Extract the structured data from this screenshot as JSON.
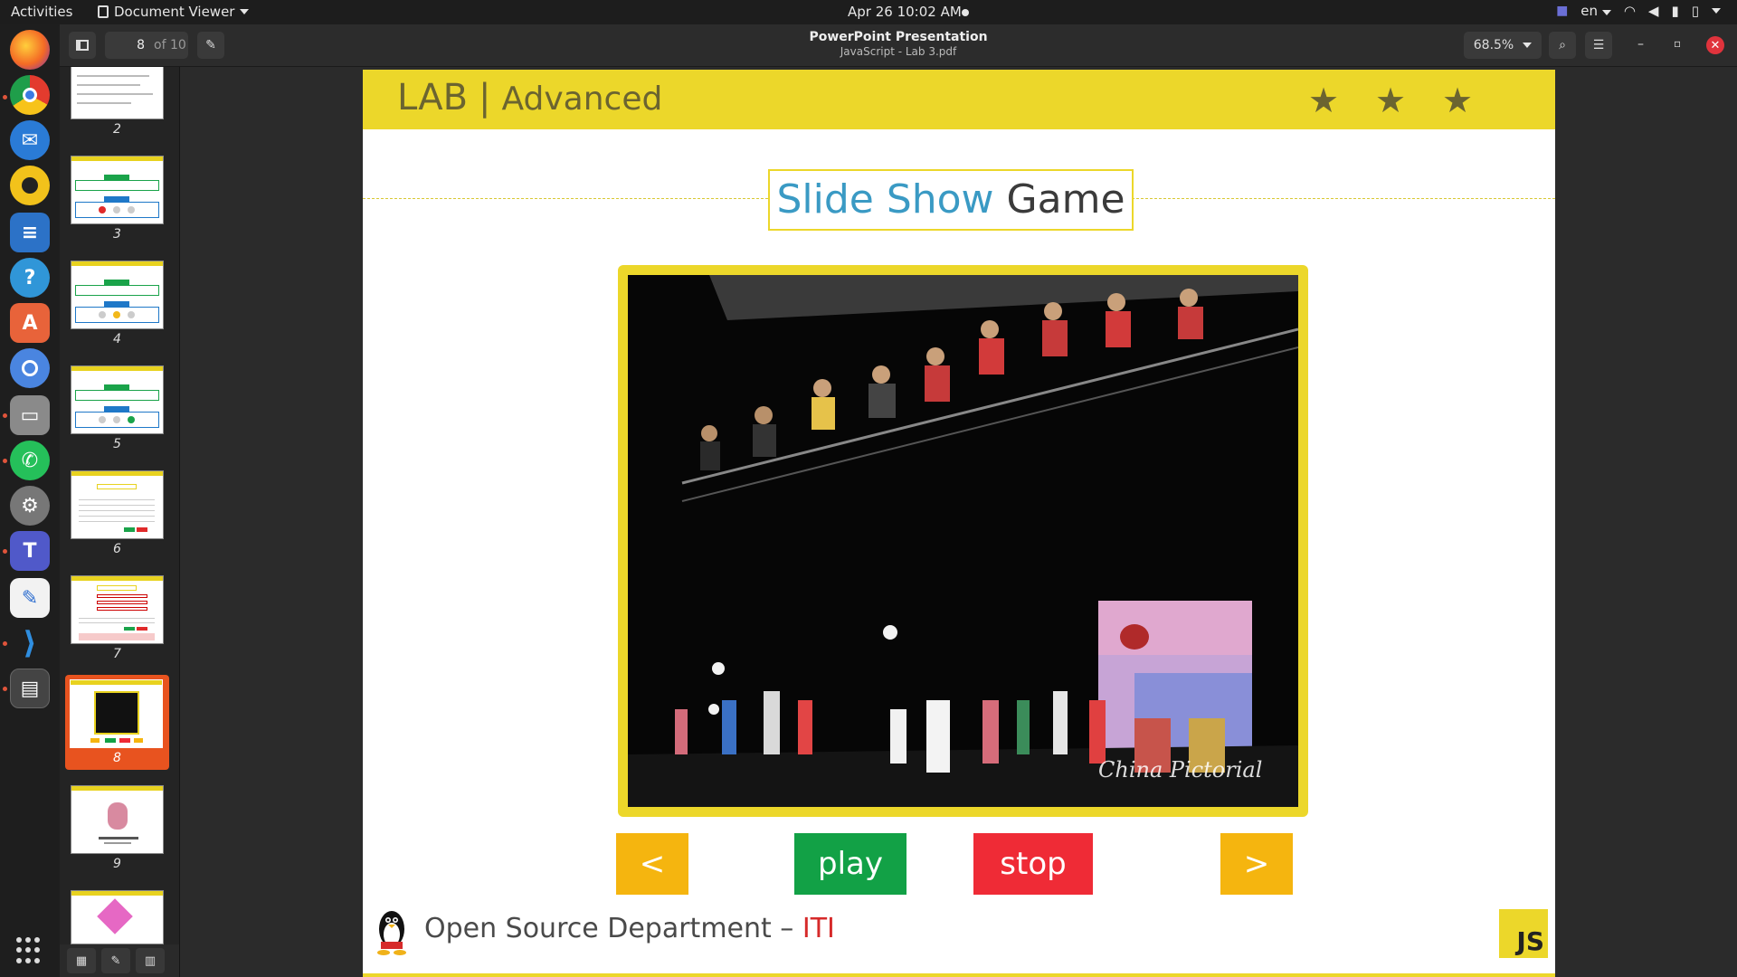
{
  "topbar": {
    "activities": "Activities",
    "app_name": "Document Viewer",
    "clock": "Apr 26  10:02 AM",
    "lang": "en"
  },
  "header": {
    "page_current": "8",
    "page_total": "of 10",
    "title": "PowerPoint Presentation",
    "subtitle": "JavaScript - Lab 3.pdf",
    "zoom": "68.5%"
  },
  "sidebar": {
    "pages": [
      "2",
      "3",
      "4",
      "5",
      "6",
      "7",
      "8",
      "9"
    ],
    "active_page": "8"
  },
  "slide": {
    "lab": "LAB",
    "separator": "|",
    "level": "Advanced",
    "stars": [
      "★",
      "★",
      "★"
    ],
    "title_part1": "Slide Show",
    "title_part2": "Game",
    "watermark": "China Pictorial",
    "buttons": {
      "prev": "<",
      "play": "play",
      "stop": "stop",
      "next": ">"
    },
    "footer_text": "Open Source Department –",
    "footer_org": "ITI",
    "badge": "JS"
  },
  "colors": {
    "slide_yellow": "#ecd72a",
    "prev_next": "#f5b50f",
    "play": "#12a146",
    "stop": "#ef2b36",
    "title_blue": "#3a9ac4",
    "active_thumb": "#e8531f"
  }
}
